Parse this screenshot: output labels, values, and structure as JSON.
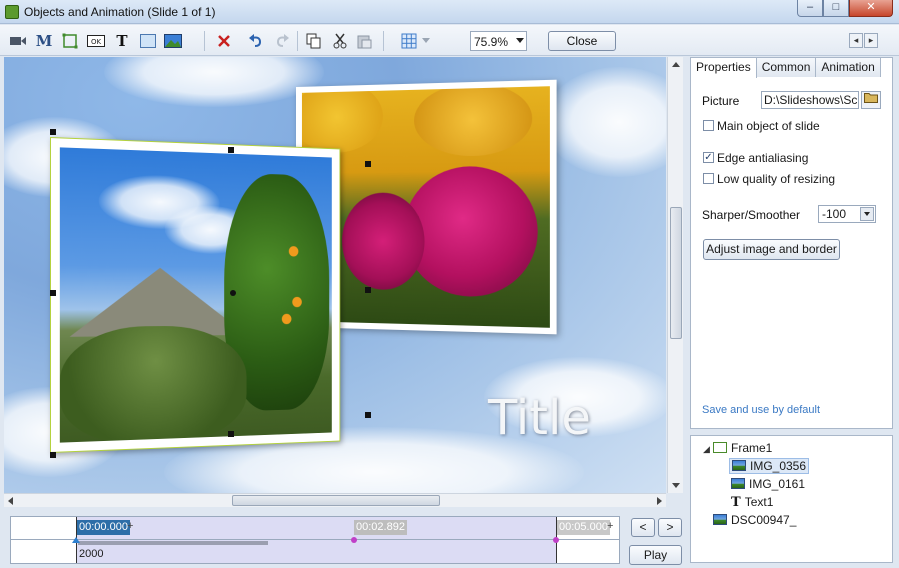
{
  "window": {
    "title": "Objects and Animation  (Slide 1 of 1)",
    "controls": {
      "minimize": "–",
      "maximize": "□",
      "close": "✕"
    }
  },
  "toolbar": {
    "icons": [
      "video-icon",
      "mask-icon",
      "frame-icon",
      "button-icon",
      "text-icon",
      "rectangle-icon",
      "image-icon",
      "delete-icon",
      "undo-icon",
      "redo-icon",
      "copy-icon",
      "cut-icon",
      "paste-icon",
      "grid-icon"
    ],
    "mask_label": "M",
    "button_label": "OK",
    "text_label": "T",
    "zoom_value": "75.9%",
    "close_label": "Close",
    "nav_prev": "◂",
    "nav_next": "▸"
  },
  "canvas": {
    "slide_title": "Title"
  },
  "tabs": [
    {
      "label": "Properties",
      "active": true
    },
    {
      "label": "Common",
      "active": false
    },
    {
      "label": "Animation",
      "active": false
    }
  ],
  "properties": {
    "picture_label": "Picture",
    "picture_path": "D:\\Slideshows\\Scre",
    "main_object_label": "Main object of slide",
    "main_object_checked": false,
    "edge_antialiasing_label": "Edge antialiasing",
    "edge_antialiasing_checked": true,
    "low_quality_label": "Low quality of resizing",
    "low_quality_checked": false,
    "sharper_label": "Sharper/Smoother",
    "sharper_value": "-100",
    "adjust_button": "Adjust image and border",
    "save_default_link": "Save and use by default"
  },
  "object_tree": {
    "expander": "◢",
    "items": [
      {
        "label": "Frame1",
        "icon": "frame-icon",
        "indent": 0,
        "selected": false
      },
      {
        "label": "IMG_0356",
        "icon": "image-icon",
        "indent": 1,
        "selected": true
      },
      {
        "label": "IMG_0161",
        "icon": "image-icon",
        "indent": 1,
        "selected": false
      },
      {
        "label": "Text1",
        "icon": "text-icon",
        "indent": 1,
        "selected": false
      },
      {
        "label": "DSC00947_",
        "icon": "image-icon",
        "indent": 0,
        "selected": false
      }
    ],
    "text_icon_glyph": "T"
  },
  "timeline": {
    "start_time": "00:00.000",
    "mid_time": "00:02.892",
    "end_time": "00:05.000",
    "plus": "+",
    "duration": "2000",
    "prev_label": "<",
    "next_label": ">",
    "play_label": "Play"
  },
  "colors": {
    "selection_blue": "#2d6ea8",
    "keyframe_magenta": "#c040c8",
    "link_blue": "#3a79c4"
  }
}
